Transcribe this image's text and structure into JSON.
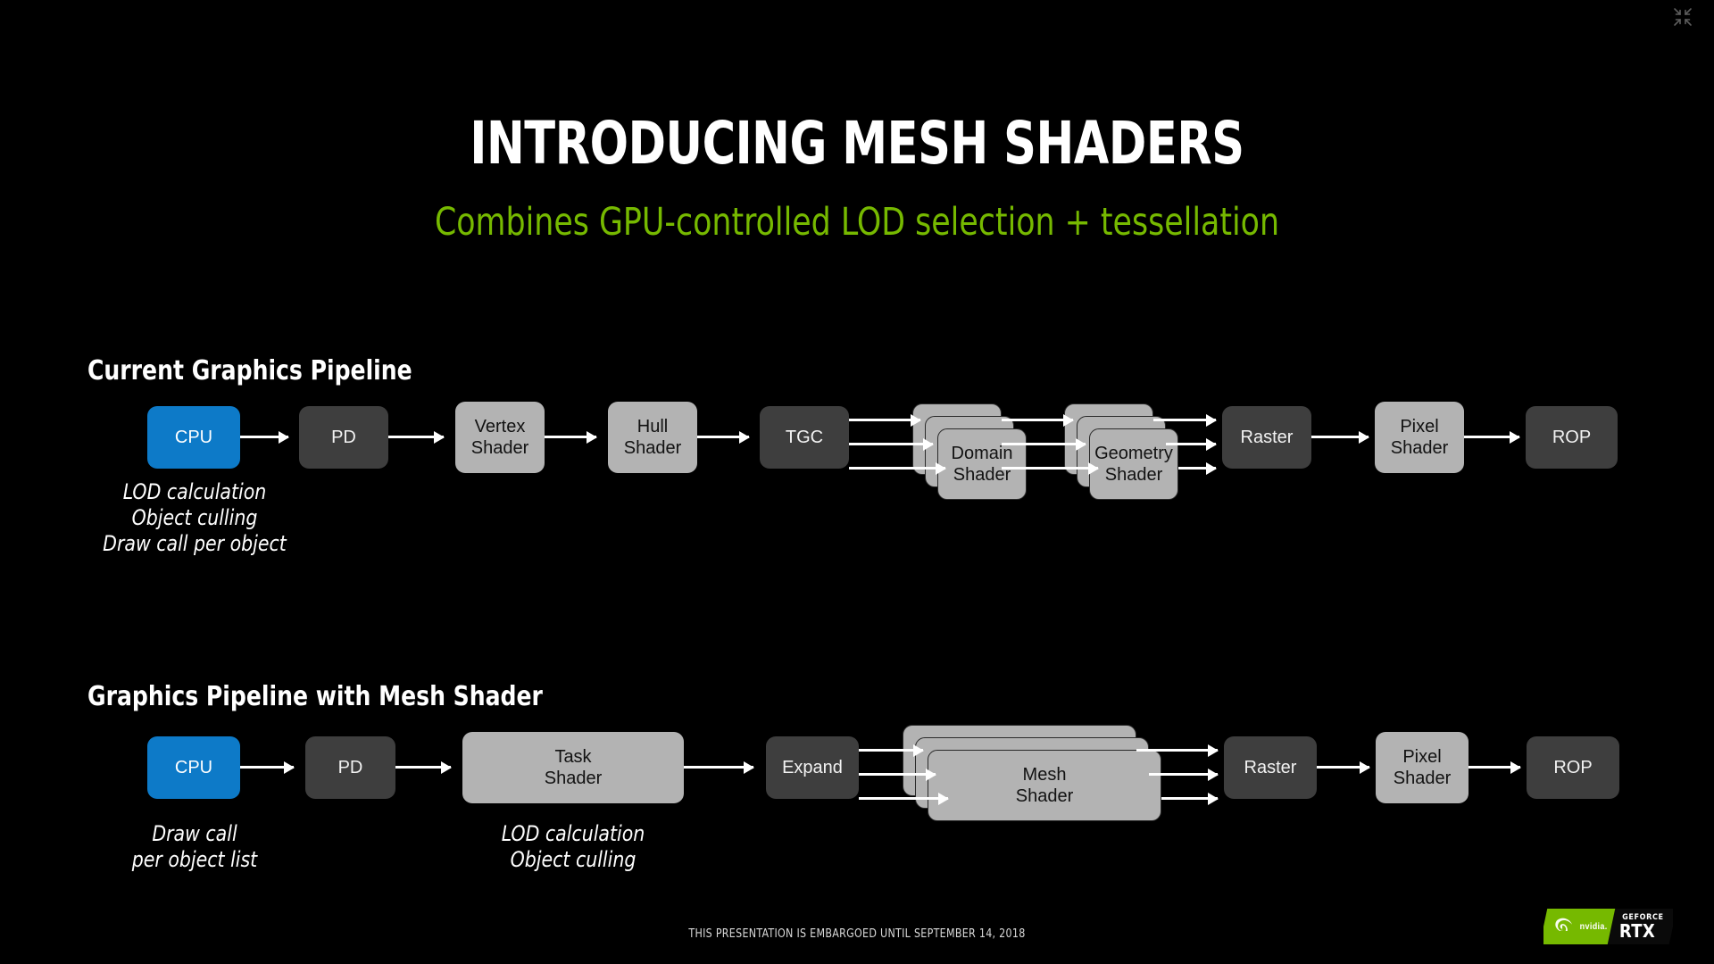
{
  "slide": {
    "title": "INTRODUCING MESH SHADERS",
    "subtitle": "Combines GPU-controlled LOD selection + tessellation",
    "background_color": "#000000",
    "accent_color": "#76b900",
    "cpu_color": "#0d7ac8",
    "dark_box_color": "#3e3e3e",
    "light_box_color": "#b3b3b3"
  },
  "collapse_icon": {
    "name": "collapse-fullscreen-icon"
  },
  "sections": [
    {
      "id": "current",
      "heading": "Current Graphics Pipeline",
      "stages": [
        {
          "id": "cpu",
          "label": "CPU",
          "style": "blue",
          "stacked": false
        },
        {
          "id": "pd",
          "label": "PD",
          "style": "dark",
          "stacked": false
        },
        {
          "id": "vertex",
          "label": "Vertex\nShader",
          "style": "light",
          "stacked": false
        },
        {
          "id": "hull",
          "label": "Hull\nShader",
          "style": "light",
          "stacked": false
        },
        {
          "id": "tgc",
          "label": "TGC",
          "style": "dark",
          "stacked": false
        },
        {
          "id": "domain",
          "label": "Domain\nShader",
          "style": "light",
          "stacked": true,
          "stack_count": 3
        },
        {
          "id": "geometry",
          "label": "Geometry\nShader",
          "style": "light",
          "stacked": true,
          "stack_count": 3
        },
        {
          "id": "raster",
          "label": "Raster",
          "style": "dark",
          "stacked": false
        },
        {
          "id": "pixel",
          "label": "Pixel\nShader",
          "style": "light",
          "stacked": false
        },
        {
          "id": "rop",
          "label": "ROP",
          "style": "dark",
          "stacked": false
        }
      ],
      "notes": [
        {
          "id": "cpu-note",
          "text": "LOD calculation\nObject culling\nDraw call per object"
        }
      ]
    },
    {
      "id": "mesh",
      "heading": "Graphics Pipeline with Mesh Shader",
      "stages": [
        {
          "id": "cpu2",
          "label": "CPU",
          "style": "blue",
          "stacked": false
        },
        {
          "id": "pd2",
          "label": "PD",
          "style": "dark",
          "stacked": false
        },
        {
          "id": "task",
          "label": "Task\nShader",
          "style": "light",
          "stacked": false
        },
        {
          "id": "expand",
          "label": "Expand",
          "style": "dark",
          "stacked": false
        },
        {
          "id": "meshsh",
          "label": "Mesh\nShader",
          "style": "light",
          "stacked": true,
          "stack_count": 3
        },
        {
          "id": "raster2",
          "label": "Raster",
          "style": "dark",
          "stacked": false
        },
        {
          "id": "pixel2",
          "label": "Pixel\nShader",
          "style": "light",
          "stacked": false
        },
        {
          "id": "rop2",
          "label": "ROP",
          "style": "dark",
          "stacked": false
        }
      ],
      "notes": [
        {
          "id": "cpu2-note",
          "text": "Draw call\nper object list"
        },
        {
          "id": "task-note",
          "text": "LOD calculation\nObject culling"
        }
      ]
    }
  ],
  "footer": {
    "embargo_note": "THIS PRESENTATION IS EMBARGOED UNTIL SEPTEMBER 14, 2018",
    "logo": {
      "brand": "nvidia.",
      "product_line": "GEFORCE",
      "product": "RTX"
    }
  }
}
